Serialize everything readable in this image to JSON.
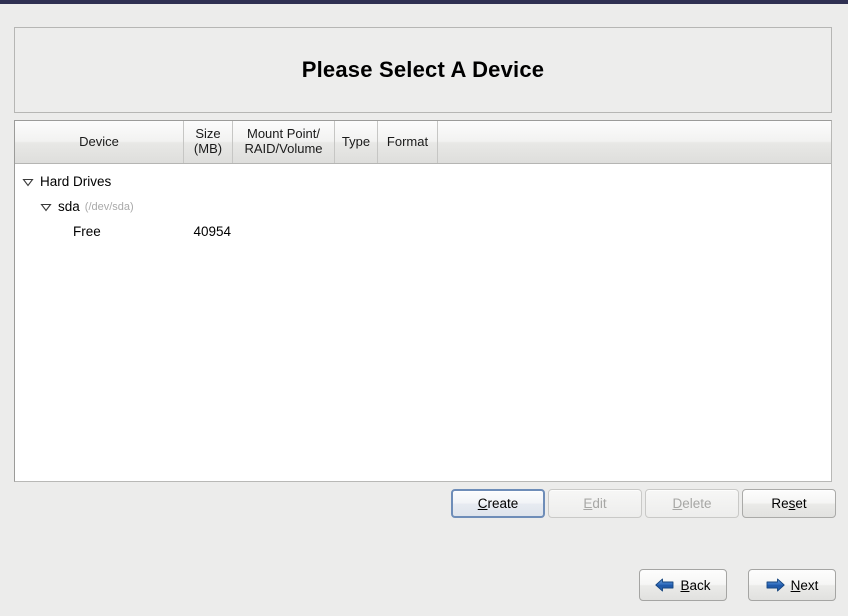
{
  "window": {
    "top_strip_color": "#2f3052",
    "background_color": "#ececeb"
  },
  "header": {
    "title": "Please Select A Device"
  },
  "device_table": {
    "columns": [
      {
        "label": "Device"
      },
      {
        "label": "Size\n(MB)",
        "line1": "Size",
        "line2": "(MB)"
      },
      {
        "label": "Mount Point/\nRAID/Volume",
        "line1": "Mount Point/",
        "line2": "RAID/Volume"
      },
      {
        "label": "Type"
      },
      {
        "label": "Format"
      },
      {
        "label": ""
      }
    ],
    "rows": [
      {
        "device": "Hard Drives",
        "device_detail": "",
        "size": "",
        "mount_point": "",
        "type": "",
        "format": "",
        "level": 1,
        "expander": "expanded"
      },
      {
        "device": "sda",
        "device_detail": "(/dev/sda)",
        "size": "",
        "mount_point": "",
        "type": "",
        "format": "",
        "level": 2,
        "expander": "expanded"
      },
      {
        "device": "Free",
        "device_detail": "",
        "size": "40954",
        "mount_point": "",
        "type": "",
        "format": "",
        "level": 3,
        "expander": "none"
      }
    ]
  },
  "action_buttons": {
    "create": {
      "label": "Create",
      "mnemonic": "C",
      "rest": "reate",
      "state": "focused"
    },
    "edit": {
      "label": "Edit",
      "mnemonic": "E",
      "rest": "dit",
      "state": "disabled"
    },
    "delete": {
      "label": "Delete",
      "mnemonic": "D",
      "rest": "elete",
      "state": "disabled"
    },
    "reset": {
      "label": "Reset",
      "pre": "Re",
      "mnemonic": "s",
      "rest": "et",
      "state": "normal"
    }
  },
  "nav_buttons": {
    "back": {
      "label": "Back",
      "mnemonic": "B",
      "rest": "ack",
      "icon": "arrow-left-icon",
      "icon_color": "#2b63b5"
    },
    "next": {
      "label": "Next",
      "mnemonic": "N",
      "rest": "ext",
      "icon": "arrow-right-icon",
      "icon_color": "#2b63b5"
    }
  }
}
